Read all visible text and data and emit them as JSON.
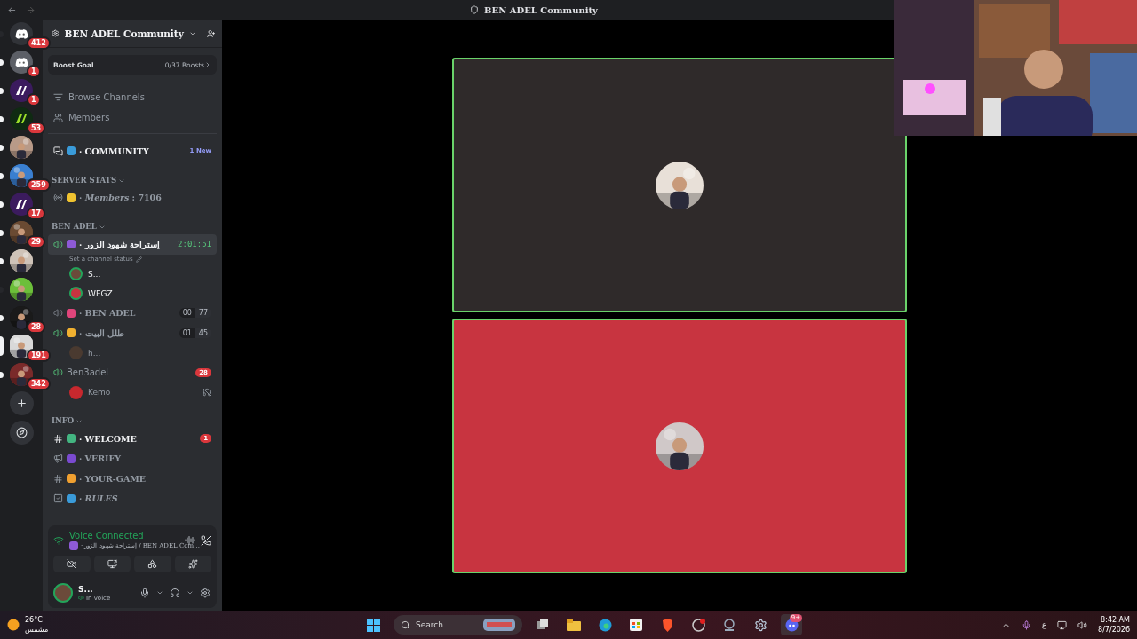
{
  "window": {
    "title": "BEN ADEL Community"
  },
  "servers": [
    {
      "kind": "discord",
      "badge": "412",
      "unread": false,
      "selected": false
    },
    {
      "kind": "discord",
      "badge": "1",
      "unread": true,
      "selected": false
    },
    {
      "kind": "mark",
      "badge": "1",
      "unread": true,
      "selected": false
    },
    {
      "kind": "mark",
      "badge": "53",
      "unread": true,
      "selected": false
    },
    {
      "kind": "picture",
      "unread": true,
      "selected": false
    },
    {
      "kind": "picture",
      "badge": "259",
      "unread": true,
      "selected": false
    },
    {
      "kind": "mark",
      "badge": "17",
      "unread": true,
      "selected": false
    },
    {
      "kind": "picture",
      "badge": "29",
      "unread": true,
      "selected": false
    },
    {
      "kind": "picture",
      "unread": true,
      "selected": false
    },
    {
      "kind": "picture",
      "unread": false,
      "selected": false
    },
    {
      "kind": "picture",
      "badge": "28",
      "unread": true,
      "selected": false
    },
    {
      "kind": "picture",
      "badge": "191",
      "unread": false,
      "selected": true
    },
    {
      "kind": "picture",
      "badge": "342",
      "unread": true,
      "selected": false
    }
  ],
  "server": {
    "name": "BEN ADEL Community",
    "boost": {
      "label": "Boost Goal",
      "progress": "0/37 Boosts",
      "level": 0
    }
  },
  "nav": [
    {
      "kind": "browse",
      "label": "Browse Channels"
    },
    {
      "kind": "members",
      "label": "Members"
    }
  ],
  "channels": [
    {
      "kind": "forum",
      "emoji": true,
      "name": "· COMMUNITY",
      "badge": "1 New",
      "unread": true
    },
    {
      "kind": "category",
      "name": "SERVER STATS",
      "children": [
        {
          "kind": "stage",
          "emoji": true,
          "name": "· ",
          "italic_name": "Members",
          "suffix": " : 7106"
        }
      ]
    },
    {
      "kind": "category",
      "name": "BEN ADEL",
      "children": [
        {
          "kind": "voice",
          "emoji": true,
          "name": "· إستراحة شهود الزور",
          "timer": "2:01:51",
          "selected": true,
          "muted": false,
          "status": "Set a channel status",
          "children": [
            {
              "name": "S...",
              "deafened": false
            },
            {
              "name": "WEGZ",
              "deafened": false
            }
          ]
        },
        {
          "kind": "voice",
          "emoji": true,
          "name": "· BEN ADEL",
          "counter": [
            "00",
            "77"
          ],
          "selected": false,
          "muted": true
        },
        {
          "kind": "voice",
          "emoji": true,
          "name": "· طلل البيت",
          "counter": [
            "01",
            "45"
          ],
          "selected": false,
          "muted": false,
          "children": [
            {
              "name": "h...",
              "deafened": false
            }
          ]
        },
        {
          "kind": "voice",
          "emoji": false,
          "name": "Ben3adel",
          "badge": "28",
          "selected": false,
          "muted": false,
          "children": [
            {
              "name": "Kemo",
              "deafened": true
            }
          ]
        }
      ]
    },
    {
      "kind": "category",
      "name": "INFO",
      "children": [
        {
          "kind": "text",
          "emoji": true,
          "name": "· WELCOME",
          "badge": "1",
          "unread": true,
          "italic": false
        },
        {
          "kind": "announcement",
          "emoji": true,
          "name": "· VERIFY",
          "unread": false,
          "italic": false
        },
        {
          "kind": "text",
          "emoji": true,
          "name": "· YOUR-GAME",
          "unread": false,
          "italic": false
        },
        {
          "kind": "rules",
          "emoji": true,
          "name": "· RULES",
          "italic": true,
          "unread": false
        }
      ]
    }
  ],
  "voice_panel": {
    "title": "Voice Connected",
    "location": "· إستراحة شهود الزور / BEN ADEL Com..."
  },
  "user": {
    "name": "S...",
    "status": "In voice"
  },
  "stage": {
    "tiles": [
      {
        "color": "#2f2a2a",
        "speaking": true
      },
      {
        "color": "#c83440",
        "speaking": true
      }
    ]
  },
  "taskbar": {
    "weather": {
      "temp": "26°C",
      "condition": "مشمس"
    },
    "search": {
      "placeholder": "Search"
    },
    "discord_badge": "9+",
    "language": "ع",
    "time": "8:42 AM",
    "date": "8/7/2026"
  }
}
